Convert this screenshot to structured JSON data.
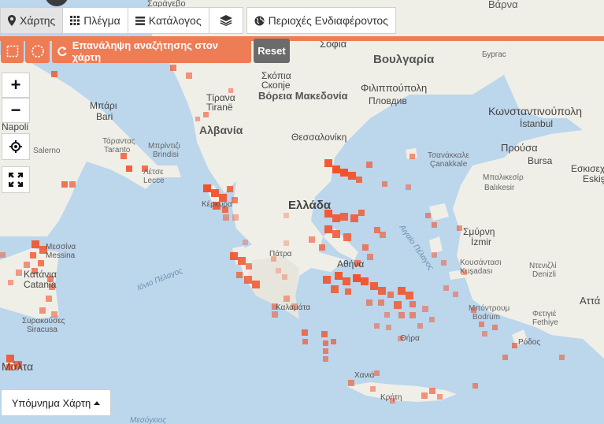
{
  "tabs": [
    {
      "label": "Χάρτης",
      "icon": "map-marker-icon",
      "active": true
    },
    {
      "label": "Πλέγμα",
      "icon": "grid-icon",
      "active": false
    },
    {
      "label": "Κατάλογος",
      "icon": "list-icon",
      "active": false
    },
    {
      "label": "",
      "icon": "layers-icon",
      "active": false
    },
    {
      "label": "Περιοχές Ενδιαφέροντος",
      "icon": "globe-icon",
      "active": false
    }
  ],
  "search_tools": {
    "rectangle_select_icon": "rectangle-select-icon",
    "circle_select_icon": "circle-select-icon",
    "repeat_search_label": "Επανάληψη αναζήτησης στον χάρτη",
    "reset_label": "Reset"
  },
  "zoom": {
    "in_label": "+",
    "out_label": "−"
  },
  "legend_label": "Υπόμνημα Χάρτη",
  "colors": {
    "accent": "#ee7c55",
    "occurrence_cell": "#f2522b",
    "sea": "#bcd6ec",
    "land": "#efefe8"
  },
  "map_labels": {
    "sea_labels": [
      "Ιόνιο Πέλαγος",
      "Αιγαίο Πέλαγος",
      "Μεσόγειος"
    ],
    "countries": [
      "Ελλάδα",
      "Αλβανία",
      "Βόρεια Μακεδονία",
      "Βουλγαρία",
      "Βάρνα"
    ],
    "cities": [
      "Σόφια",
      "Бургас",
      "Φιλιππούπολη",
      "Пловдив",
      "Κωνσταντινούπολη",
      "İstanbul",
      "Θεσσαλονίκη",
      "Τίρανα",
      "Tiranë",
      "Σκόπια",
      "Скопје",
      "Μπάρι",
      "Bari",
      "Τάραντας",
      "Taranto",
      "Μπρίντιζι",
      "Brindisi",
      "Λέτσε",
      "Lecce",
      "Napoli",
      "Salerno",
      "Προύσα",
      "Bursa",
      "Εσκισεχίρ",
      "Eskişe",
      "Μπαλικεσίρ",
      "Balıkesir",
      "Τσανάκκαλε",
      "Çanakkale",
      "Σμύρνη",
      "İzmir",
      "Κουσάντασι",
      "Kuşadası",
      "Ντενιζλί",
      "Denizli",
      "Μπόντρουμ",
      "Bodrum",
      "Φετιγιέ",
      "Fethiye",
      "Αττά",
      "Ρόδος",
      "Χανιά",
      "Κρήτη",
      "Θήρα",
      "Αθήνα",
      "Πάτρα",
      "Καλαμάτα",
      "Κέρκυρα",
      "Μεσσίνα",
      "Messina",
      "Κατάνια",
      "Catania",
      "Συρακούσες",
      "Siracusa",
      "Μάλτα",
      "Σαράγεβο"
    ]
  }
}
